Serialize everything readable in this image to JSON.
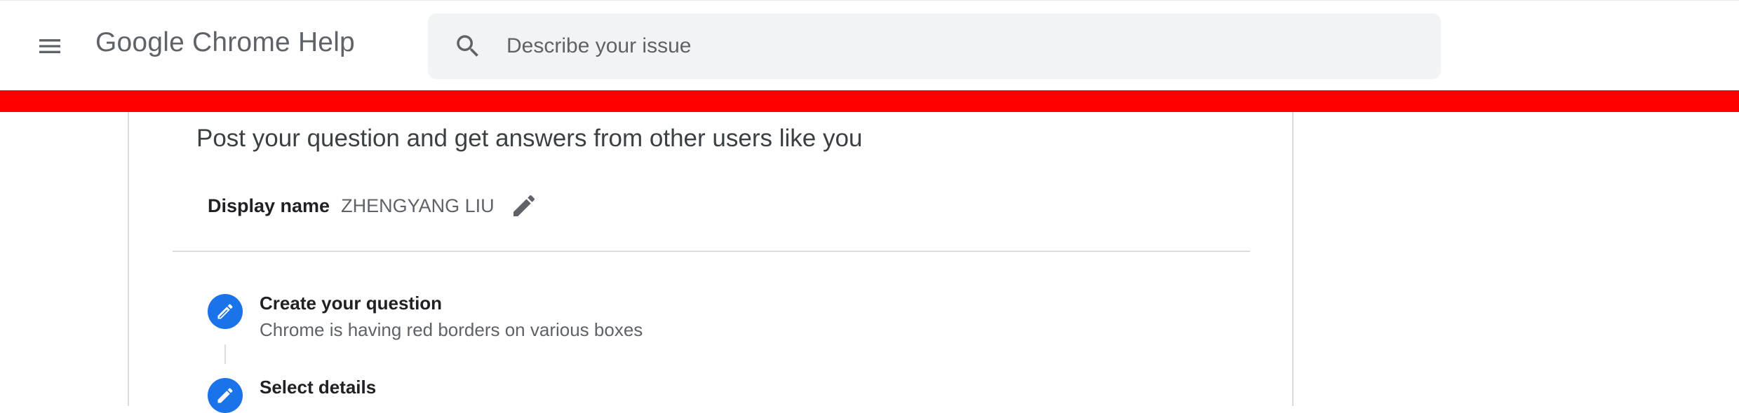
{
  "header": {
    "menu_icon": "hamburger-menu-icon",
    "title": "Google Chrome Help",
    "search": {
      "icon": "search-icon",
      "placeholder": "Describe your issue",
      "value": ""
    }
  },
  "colors": {
    "highlight_bar": "#ff0000",
    "accent": "#1a73e8",
    "search_bg": "#f1f3f4"
  },
  "form": {
    "subtitle": "Post your question and get answers from other users like you",
    "display_name": {
      "label": "Display name",
      "value": "ZHENGYANG LIU",
      "edit_icon": "pencil-icon"
    },
    "steps": [
      {
        "title": "Create your question",
        "description": "Chrome is having red borders on various boxes",
        "icon": "pencil-icon"
      },
      {
        "title": "Select details",
        "description": "",
        "icon": "pencil-icon"
      }
    ]
  }
}
